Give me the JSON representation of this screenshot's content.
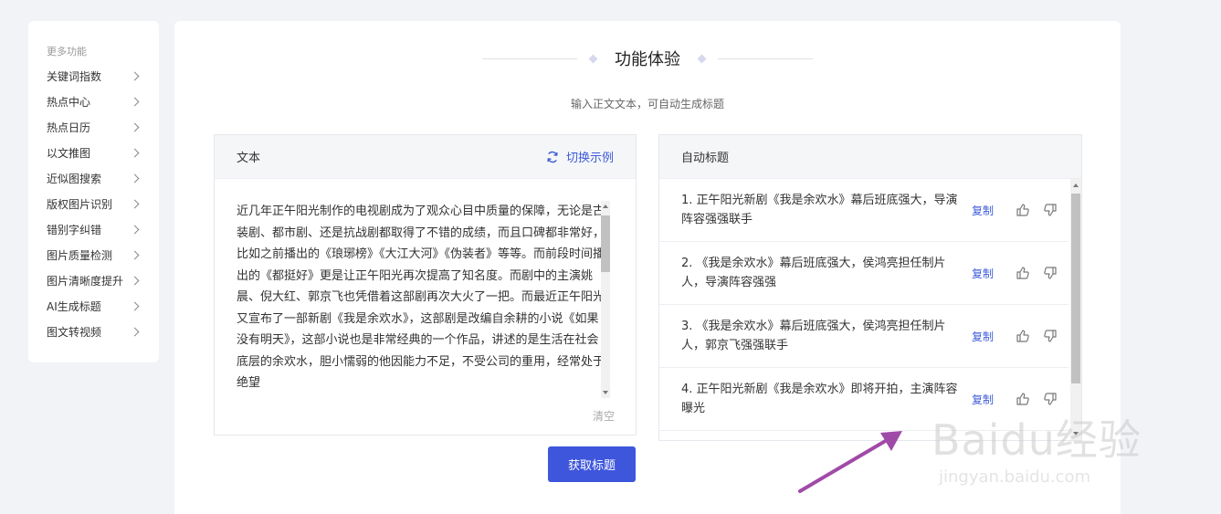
{
  "sidebar": {
    "title": "更多功能",
    "items": [
      {
        "label": "关键词指数"
      },
      {
        "label": "热点中心"
      },
      {
        "label": "热点日历"
      },
      {
        "label": "以文推图"
      },
      {
        "label": "近似图搜索"
      },
      {
        "label": "版权图片识别"
      },
      {
        "label": "错别字纠错"
      },
      {
        "label": "图片质量检测"
      },
      {
        "label": "图片清晰度提升"
      },
      {
        "label": "AI生成标题"
      },
      {
        "label": "图文转视频"
      }
    ]
  },
  "main": {
    "title": "功能体验",
    "subtitle": "输入正文文本，可自动生成标题",
    "text_panel": {
      "header": "文本",
      "switch_label": "切换示例",
      "body": "近几年正午阳光制作的电视剧成为了观众心目中质量的保障，无论是古装剧、都市剧、还是抗战剧都取得了不错的成绩，而且口碑都非常好，比如之前播出的《琅琊榜》《大江大河》《伪装者》等等。而前段时间播出的《都挺好》更是让正午阳光再次提高了知名度。而剧中的主演姚晨、倪大红、郭京飞也凭借着这部剧再次大火了一把。而最近正午阳光又宣布了一部新剧《我是余欢水》，这部剧是改编自余耕的小说《如果没有明天》，这部小说也是非常经典的一个作品，讲述的是生活在社会底层的余欢水，胆小懦弱的他因能力不足，不受公司的重用，经常处于绝望",
      "clear_label": "清空"
    },
    "result_panel": {
      "header": "自动标题",
      "copy_label": "复制",
      "results": [
        {
          "text": "1. 正午阳光新剧《我是余欢水》幕后班底强大，导演阵容强强联手"
        },
        {
          "text": "2. 《我是余欢水》幕后班底强大，侯鸿亮担任制片人，导演阵容强强"
        },
        {
          "text": "3. 《我是余欢水》幕后班底强大，侯鸿亮担任制片人，郭京飞强强联手"
        },
        {
          "text": "4. 正午阳光新剧《我是余欢水》即将开拍，主演阵容曝光"
        }
      ]
    },
    "button_label": "获取标题"
  },
  "watermark": {
    "logo": "Baidu经验",
    "url": "jingyan.baidu.com"
  },
  "colors": {
    "accent": "#3d56db",
    "link": "#3d5bd8",
    "arrow": "#a04aa8"
  },
  "icons": {
    "switch": "refresh-icon",
    "like": "thumbs-up-icon",
    "dislike": "thumbs-down-icon",
    "chevron": "chevron-right-icon"
  }
}
